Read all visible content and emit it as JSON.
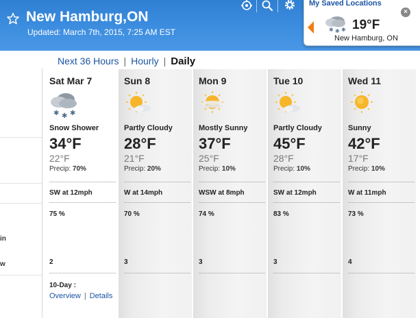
{
  "header": {
    "location": "New Hamburg,ON",
    "updated": "Updated: March 7th, 2015, 7:25 AM EST"
  },
  "saved": {
    "title": "My Saved Locations",
    "close": "×",
    "temp": "19°F",
    "city": "New Hamburg, ON"
  },
  "left_panel": {
    "row1": "in",
    "row2": "w"
  },
  "tabs": {
    "next36": "Next 36 Hours",
    "hourly": "Hourly",
    "daily": "Daily",
    "sep": "|"
  },
  "days": [
    {
      "name": "Sat Mar 7",
      "icon": "snow-shower-icon",
      "condition": "Snow Shower",
      "high": "34°F",
      "low": "22°F",
      "precip_label": "Precip:",
      "precip": "70%",
      "wind": "SW at 12mph",
      "humidity": "75 %",
      "uv": "2"
    },
    {
      "name": "Sun 8",
      "icon": "partly-cloudy-icon",
      "condition": "Partly Cloudy",
      "high": "28°F",
      "low": "21°F",
      "precip_label": "Precip:",
      "precip": "20%",
      "wind": "W at 14mph",
      "humidity": "70 %",
      "uv": "3"
    },
    {
      "name": "Mon 9",
      "icon": "mostly-sunny-icon",
      "condition": "Mostly Sunny",
      "high": "37°F",
      "low": "25°F",
      "precip_label": "Precip:",
      "precip": "10%",
      "wind": "WSW at 8mph",
      "humidity": "74 %",
      "uv": "3"
    },
    {
      "name": "Tue 10",
      "icon": "partly-cloudy-icon",
      "condition": "Partly Cloudy",
      "high": "45°F",
      "low": "28°F",
      "precip_label": "Precip:",
      "precip": "10%",
      "wind": "SW at 12mph",
      "humidity": "83 %",
      "uv": "3"
    },
    {
      "name": "Wed 11",
      "icon": "sunny-icon",
      "condition": "Sunny",
      "high": "42°F",
      "low": "17°F",
      "precip_label": "Precip:",
      "precip": "10%",
      "wind": "W at 11mph",
      "humidity": "73 %",
      "uv": "4"
    }
  ],
  "ten_day": {
    "label": "10-Day :",
    "overview": "Overview",
    "sep": "|",
    "details": "Details"
  },
  "colors": {
    "header_blue": "#3d8ee0",
    "link_blue": "#1b54a3",
    "accent_orange": "#f07e12"
  }
}
